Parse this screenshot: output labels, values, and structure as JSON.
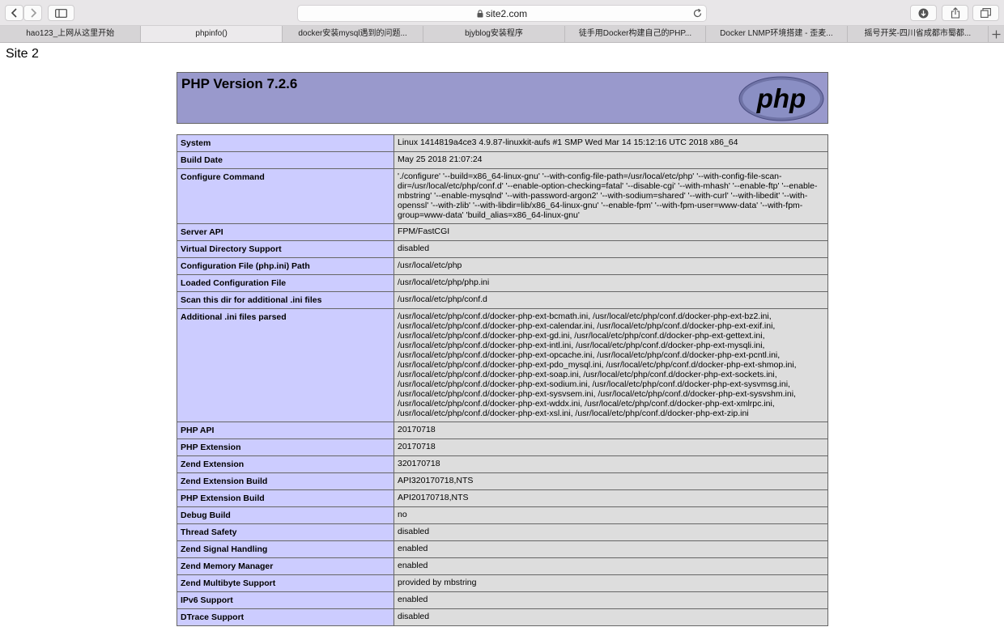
{
  "browser": {
    "address": "site2.com",
    "icons": [
      "back-icon",
      "forward-icon",
      "sidebar-icon",
      "lock-icon",
      "reload-icon",
      "download-icon",
      "share-icon",
      "tabs-overview-icon",
      "new-tab-icon"
    ],
    "tabs": [
      {
        "label": "hao123_上网从这里开始"
      },
      {
        "label": "phpinfo()"
      },
      {
        "label": "docker安装mysql遇到的问题..."
      },
      {
        "label": "bjyblog安装程序"
      },
      {
        "label": "徒手用Docker构建自己的PHP..."
      },
      {
        "label": "Docker LNMP环境搭建 - 歪麦..."
      },
      {
        "label": "摇号开奖-四川省成都市蜀都..."
      }
    ]
  },
  "page": {
    "site_label": "Site 2",
    "php_version": "PHP Version 7.2.6",
    "logo_text": "php",
    "colors": {
      "header": "#9999cc",
      "label_cell": "#ccccff",
      "value_cell": "#dddddd"
    },
    "rows": [
      {
        "k": "System",
        "v": "Linux 1414819a4ce3 4.9.87-linuxkit-aufs #1 SMP Wed Mar 14 15:12:16 UTC 2018 x86_64"
      },
      {
        "k": "Build Date",
        "v": "May 25 2018 21:07:24"
      },
      {
        "k": "Configure Command",
        "v": "'./configure' '--build=x86_64-linux-gnu' '--with-config-file-path=/usr/local/etc/php' '--with-config-file-scan-dir=/usr/local/etc/php/conf.d' '--enable-option-checking=fatal' '--disable-cgi' '--with-mhash' '--enable-ftp' '--enable-mbstring' '--enable-mysqlnd' '--with-password-argon2' '--with-sodium=shared' '--with-curl' '--with-libedit' '--with-openssl' '--with-zlib' '--with-libdir=lib/x86_64-linux-gnu' '--enable-fpm' '--with-fpm-user=www-data' '--with-fpm-group=www-data' 'build_alias=x86_64-linux-gnu'"
      },
      {
        "k": "Server API",
        "v": "FPM/FastCGI"
      },
      {
        "k": "Virtual Directory Support",
        "v": "disabled"
      },
      {
        "k": "Configuration File (php.ini) Path",
        "v": "/usr/local/etc/php"
      },
      {
        "k": "Loaded Configuration File",
        "v": "/usr/local/etc/php/php.ini"
      },
      {
        "k": "Scan this dir for additional .ini files",
        "v": "/usr/local/etc/php/conf.d"
      },
      {
        "k": "Additional .ini files parsed",
        "v": "/usr/local/etc/php/conf.d/docker-php-ext-bcmath.ini, /usr/local/etc/php/conf.d/docker-php-ext-bz2.ini, /usr/local/etc/php/conf.d/docker-php-ext-calendar.ini, /usr/local/etc/php/conf.d/docker-php-ext-exif.ini, /usr/local/etc/php/conf.d/docker-php-ext-gd.ini, /usr/local/etc/php/conf.d/docker-php-ext-gettext.ini, /usr/local/etc/php/conf.d/docker-php-ext-intl.ini, /usr/local/etc/php/conf.d/docker-php-ext-mysqli.ini, /usr/local/etc/php/conf.d/docker-php-ext-opcache.ini, /usr/local/etc/php/conf.d/docker-php-ext-pcntl.ini, /usr/local/etc/php/conf.d/docker-php-ext-pdo_mysql.ini, /usr/local/etc/php/conf.d/docker-php-ext-shmop.ini, /usr/local/etc/php/conf.d/docker-php-ext-soap.ini, /usr/local/etc/php/conf.d/docker-php-ext-sockets.ini, /usr/local/etc/php/conf.d/docker-php-ext-sodium.ini, /usr/local/etc/php/conf.d/docker-php-ext-sysvmsg.ini, /usr/local/etc/php/conf.d/docker-php-ext-sysvsem.ini, /usr/local/etc/php/conf.d/docker-php-ext-sysvshm.ini, /usr/local/etc/php/conf.d/docker-php-ext-wddx.ini, /usr/local/etc/php/conf.d/docker-php-ext-xmlrpc.ini, /usr/local/etc/php/conf.d/docker-php-ext-xsl.ini, /usr/local/etc/php/conf.d/docker-php-ext-zip.ini"
      },
      {
        "k": "PHP API",
        "v": "20170718"
      },
      {
        "k": "PHP Extension",
        "v": "20170718"
      },
      {
        "k": "Zend Extension",
        "v": "320170718"
      },
      {
        "k": "Zend Extension Build",
        "v": "API320170718,NTS"
      },
      {
        "k": "PHP Extension Build",
        "v": "API20170718,NTS"
      },
      {
        "k": "Debug Build",
        "v": "no"
      },
      {
        "k": "Thread Safety",
        "v": "disabled"
      },
      {
        "k": "Zend Signal Handling",
        "v": "enabled"
      },
      {
        "k": "Zend Memory Manager",
        "v": "enabled"
      },
      {
        "k": "Zend Multibyte Support",
        "v": "provided by mbstring"
      },
      {
        "k": "IPv6 Support",
        "v": "enabled"
      },
      {
        "k": "DTrace Support",
        "v": "disabled"
      }
    ]
  }
}
